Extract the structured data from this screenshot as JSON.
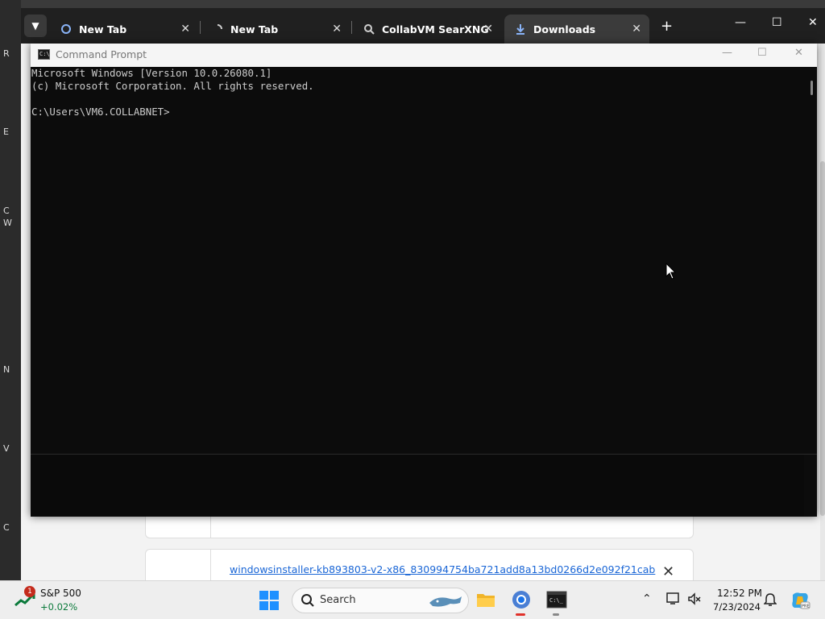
{
  "desktop": {
    "edge_letters": [
      "R",
      "E",
      "C",
      "W",
      "N",
      "V",
      "C"
    ]
  },
  "browser": {
    "tabs": [
      {
        "label": "New Tab",
        "icon": "loading-ring-icon",
        "active": false
      },
      {
        "label": "New Tab",
        "icon": "loading-spinner-icon",
        "active": false
      },
      {
        "label": "CollabVM SearXNG",
        "icon": "searxng-icon",
        "active": false
      },
      {
        "label": "Downloads",
        "icon": "download-icon",
        "active": true
      }
    ],
    "new_tab_glyph": "+",
    "download_item": {
      "filename": "windowsinstaller-kb893803-v2-x86_830994754ba721add8a13bd0266d2e092f21cab"
    }
  },
  "cmd": {
    "title": "Command Prompt",
    "lines": [
      "Microsoft Windows [Version 10.0.26080.1]",
      "(c) Microsoft Corporation. All rights reserved.",
      "",
      "C:\\Users\\VM6.COLLABNET>"
    ]
  },
  "taskbar": {
    "widget": {
      "badge": "1",
      "title": "S&P 500",
      "change": "+0.02%"
    },
    "search_placeholder": "Search",
    "time": "12:52 PM",
    "date": "7/23/2024"
  },
  "colors": {
    "cmd_bg": "#0c0c0c",
    "cmd_text": "#cccccc",
    "accent_blue": "#1a66d6",
    "taskbar_bg": "#eeeeee",
    "stock_green": "#0b7a3b",
    "badge_red": "#c42b1c"
  }
}
